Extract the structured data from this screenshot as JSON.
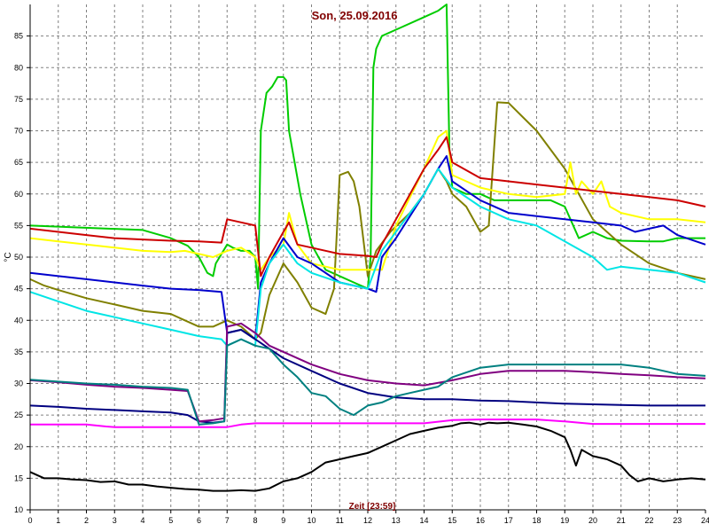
{
  "chart_data": {
    "type": "line",
    "title": "Son, 25.09.2016",
    "xlabel": "Zeit [23:59]",
    "ylabel": "°C",
    "xlim": [
      0,
      24
    ],
    "ylim": [
      10,
      90
    ],
    "xticks": [
      0,
      1,
      2,
      3,
      4,
      5,
      6,
      7,
      8,
      9,
      10,
      11,
      12,
      13,
      14,
      15,
      16,
      17,
      18,
      19,
      20,
      21,
      22,
      23,
      24
    ],
    "yticks": [
      10,
      15,
      20,
      25,
      30,
      35,
      40,
      45,
      50,
      55,
      60,
      65,
      70,
      75,
      80,
      85
    ],
    "grid": true,
    "background": "#ffffff",
    "grid_color": "#808080",
    "series": [
      {
        "color": "#00cc00",
        "x": [
          0,
          4,
          5,
          5.6,
          6,
          6.3,
          6.5,
          6.6,
          7,
          7.2,
          7.5,
          7.8,
          8,
          8.1,
          8.2,
          8.4,
          8.6,
          8.8,
          9,
          9.1,
          9.2,
          9.6,
          10,
          10.5,
          11,
          11.5,
          12,
          12.1,
          12.2,
          12.3,
          12.5,
          13,
          14,
          14.5,
          14.8,
          14.9,
          15,
          15.5,
          16,
          16.5,
          17,
          18,
          18.5,
          19,
          19.5,
          20,
          20.5,
          21,
          22,
          22.5,
          23,
          24
        ],
        "y": [
          55,
          54.3,
          53,
          51.8,
          50,
          47.5,
          47,
          49,
          52,
          51.5,
          51,
          51,
          50,
          45,
          70,
          76,
          77,
          78.5,
          78.5,
          78,
          70,
          60,
          52,
          48,
          47,
          46,
          45,
          50,
          80,
          83,
          85,
          86,
          88,
          89,
          90,
          67,
          61,
          60,
          60,
          59,
          59,
          59,
          59,
          58,
          53,
          54,
          53,
          52.6,
          52.5,
          52.5,
          53,
          53
        ]
      },
      {
        "color": "#808000",
        "x": [
          0,
          0.5,
          1,
          2,
          3,
          4,
          5,
          5.5,
          6,
          6.5,
          7,
          7.5,
          8,
          8.2,
          8.5,
          9,
          9.5,
          10,
          10.5,
          10.8,
          11,
          11.3,
          11.5,
          11.7,
          12,
          12.3,
          12.8,
          13.5,
          14,
          14.5,
          14.8,
          15,
          15.5,
          16,
          16.3,
          16.6,
          17,
          18,
          18.5,
          19,
          19.5,
          20,
          21,
          22,
          23,
          24
        ],
        "y": [
          46.5,
          45.5,
          44.8,
          43.5,
          42.5,
          41.5,
          41,
          40,
          39,
          39,
          40,
          39,
          37,
          38,
          44,
          49,
          46,
          42,
          41,
          45,
          63,
          63.5,
          62,
          58,
          47,
          51,
          54,
          57,
          60,
          64,
          62,
          60,
          58,
          54,
          55,
          74.5,
          74.4,
          70,
          67,
          64,
          60,
          56,
          52,
          49,
          47.5,
          46.5
        ]
      },
      {
        "color": "#ffff00",
        "x": [
          0,
          1,
          2,
          3,
          4,
          5,
          5.5,
          6,
          6.5,
          7,
          7.5,
          8,
          8.2,
          8.5,
          9,
          9.2,
          9.5,
          10,
          11,
          12,
          12.5,
          13,
          14,
          14.5,
          14.8,
          15,
          15.5,
          16,
          17,
          18,
          19,
          19.2,
          19.4,
          19.6,
          20,
          20.3,
          20.6,
          21,
          22,
          23,
          24
        ],
        "y": [
          53,
          52.5,
          52,
          51.5,
          51,
          50.8,
          51,
          50.5,
          50,
          51,
          51.5,
          50,
          48,
          50,
          52,
          57,
          52,
          49,
          48,
          48,
          48,
          55,
          64,
          69,
          70,
          63,
          62,
          61,
          60,
          59.5,
          60,
          65,
          60,
          62,
          60,
          62,
          58,
          57,
          56,
          56,
          55.5
        ]
      },
      {
        "color": "#cc0000",
        "x": [
          0,
          1,
          2,
          3,
          4,
          5,
          6,
          6.8,
          7,
          7.5,
          8,
          8.2,
          8.5,
          9,
          9.2,
          9.5,
          10,
          11,
          12,
          12.3,
          12.5,
          13,
          14,
          14.5,
          14.8,
          15,
          16,
          17,
          18,
          19,
          20,
          21,
          22,
          23,
          24
        ],
        "y": [
          54.5,
          54,
          53.5,
          53,
          52.8,
          52.6,
          52.5,
          52.3,
          56,
          55.5,
          55,
          47,
          50,
          54,
          55.5,
          52,
          51.5,
          50.5,
          50.2,
          50,
          52,
          56,
          64,
          67,
          69,
          65,
          62.5,
          62,
          61.5,
          61,
          60.5,
          60,
          59.5,
          59,
          58
        ]
      },
      {
        "color": "#0000cc",
        "x": [
          0,
          1,
          2,
          3,
          4,
          5,
          6,
          6.8,
          7,
          7.5,
          8,
          8.2,
          8.5,
          9,
          9.5,
          10,
          11,
          12,
          12.3,
          12.5,
          13,
          14,
          14.5,
          14.8,
          15,
          16,
          17,
          18,
          19,
          20,
          21,
          21.5,
          22,
          22.5,
          23,
          24
        ],
        "y": [
          47.5,
          47,
          46.5,
          46,
          45.5,
          45,
          44.8,
          44.5,
          38,
          38.5,
          37,
          46,
          49,
          53,
          50,
          49,
          46,
          45,
          44.5,
          50,
          53,
          60,
          64,
          66,
          62,
          59,
          57,
          56.5,
          56,
          55.5,
          55,
          54,
          54.5,
          55,
          53.5,
          52
        ]
      },
      {
        "color": "#00e5e5",
        "x": [
          0,
          1,
          2,
          3,
          4,
          5,
          6,
          6.8,
          7,
          7.5,
          8,
          8.2,
          8.5,
          9,
          9.5,
          10,
          11,
          12,
          12.5,
          13,
          14,
          14.5,
          15,
          16,
          17,
          18,
          19,
          20,
          20.5,
          21,
          22,
          23,
          24
        ],
        "y": [
          44.5,
          43,
          41.5,
          40.5,
          39.5,
          38.5,
          37.5,
          37,
          36,
          37,
          36,
          45,
          49,
          52,
          49,
          47.5,
          46,
          45,
          51,
          54,
          60,
          64,
          61,
          58,
          56,
          55,
          52.5,
          50,
          48,
          48.5,
          48,
          47.5,
          46
        ]
      },
      {
        "color": "#000080",
        "x": [
          0,
          1,
          2,
          3,
          4,
          5,
          5.6,
          6,
          6.5,
          6.9,
          7,
          7.5,
          8,
          8.5,
          9,
          10,
          11,
          12,
          13,
          14,
          15,
          16,
          17,
          18,
          19,
          20,
          21,
          22,
          23,
          24
        ],
        "y": [
          26.5,
          26.3,
          26,
          25.8,
          25.6,
          25.4,
          25,
          24,
          23.8,
          24,
          38,
          38.5,
          37,
          35.5,
          34,
          32,
          30,
          28.5,
          27.8,
          27.5,
          27.5,
          27.3,
          27.2,
          27,
          26.8,
          26.7,
          26.6,
          26.5,
          26.5,
          26.5
        ]
      },
      {
        "color": "#800080",
        "x": [
          0,
          1,
          2,
          3,
          4,
          5,
          5.6,
          6,
          6.5,
          6.9,
          7,
          7.5,
          8,
          8.5,
          9,
          10,
          11,
          12,
          13,
          14,
          15,
          16,
          17,
          18,
          19,
          20,
          21,
          22,
          23,
          24
        ],
        "y": [
          30.5,
          30.2,
          29.8,
          29.5,
          29.3,
          29,
          28.8,
          24,
          24.2,
          24.5,
          39,
          39.5,
          38,
          36,
          35,
          33,
          31.5,
          30.5,
          30,
          29.7,
          30.5,
          31.5,
          32,
          32,
          32,
          31.8,
          31.5,
          31.3,
          31,
          30.8
        ]
      },
      {
        "color": "#008080",
        "x": [
          0,
          1,
          2,
          3,
          4,
          5,
          5.6,
          6,
          6.5,
          6.9,
          7,
          7.5,
          8,
          8.5,
          9,
          9.5,
          10,
          10.5,
          11,
          11.5,
          12,
          12.5,
          13,
          13.5,
          14,
          14.5,
          15,
          16,
          17,
          18,
          19,
          20,
          21,
          22,
          23,
          24
        ],
        "y": [
          30.6,
          30.3,
          30,
          29.8,
          29.5,
          29.3,
          29,
          23.5,
          23.7,
          24,
          36,
          37,
          36,
          35.5,
          33,
          31,
          28.5,
          28,
          26,
          25,
          26.5,
          27,
          28,
          28.5,
          29,
          29.5,
          31,
          32.5,
          33,
          33,
          33,
          33,
          33,
          32.5,
          31.5,
          31.2
        ]
      },
      {
        "color": "#ff00ff",
        "x": [
          0,
          2,
          2.7,
          3,
          4,
          5,
          6,
          7,
          7.5,
          8,
          9,
          10,
          11,
          12,
          13,
          14,
          15,
          16,
          17,
          18,
          19,
          20,
          21,
          22,
          23,
          24
        ],
        "y": [
          23.5,
          23.5,
          23.2,
          23.1,
          23.1,
          23.1,
          23.1,
          23.1,
          23.5,
          23.7,
          23.7,
          23.7,
          23.7,
          23.7,
          23.7,
          23.7,
          24.2,
          24.3,
          24.3,
          24.3,
          24,
          23.6,
          23.6,
          23.6,
          23.6,
          23.6
        ]
      },
      {
        "color": "#000000",
        "x": [
          0,
          0.5,
          1,
          1.5,
          2,
          2.5,
          3,
          3.5,
          4,
          4.5,
          5,
          5.5,
          6,
          6.5,
          7,
          7.5,
          8,
          8.5,
          9,
          9.5,
          10,
          10.5,
          11,
          11.5,
          12,
          12.5,
          13,
          13.5,
          14,
          14.5,
          15,
          15.3,
          15.6,
          16,
          16.3,
          16.6,
          17,
          17.5,
          18,
          18.5,
          19,
          19.2,
          19.4,
          19.6,
          20,
          20.5,
          21,
          21.3,
          21.6,
          22,
          22.5,
          23,
          23.5,
          24
        ],
        "y": [
          16,
          15,
          15,
          14.8,
          14.7,
          14.4,
          14.5,
          14,
          14,
          13.7,
          13.5,
          13.3,
          13.2,
          13,
          13,
          13.1,
          13,
          13.4,
          14.5,
          15,
          16,
          17.5,
          18,
          18.5,
          19,
          20,
          21,
          22,
          22.5,
          23,
          23.3,
          23.7,
          23.8,
          23.5,
          23.8,
          23.7,
          23.8,
          23.5,
          23.2,
          22.5,
          21.5,
          19.5,
          17,
          19.5,
          18.5,
          18,
          17,
          15.5,
          14.5,
          15,
          14.5,
          14.8,
          15,
          14.8
        ]
      }
    ]
  }
}
